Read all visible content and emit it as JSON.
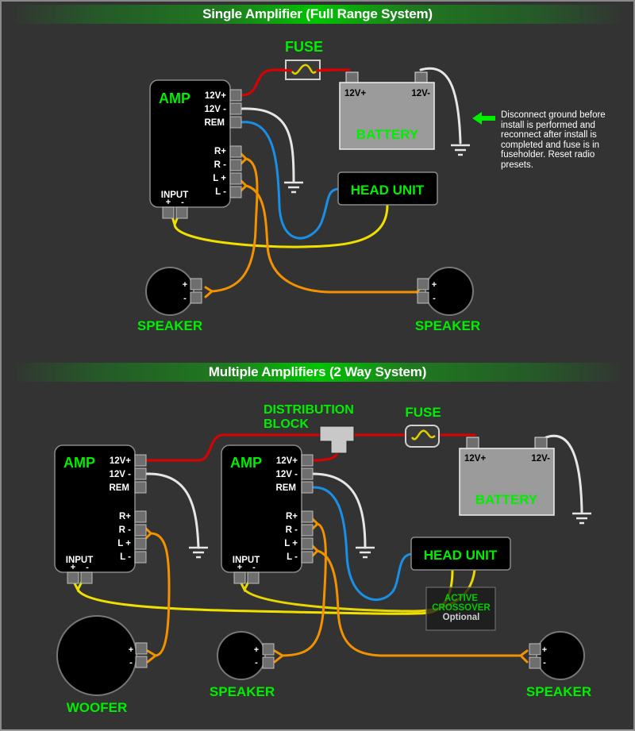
{
  "sections": [
    {
      "title": "Single Amplifier (Full Range System)",
      "fuse_label": "FUSE",
      "amp": {
        "label": "AMP",
        "terminals": [
          "12V+",
          "12V -",
          "REM",
          "R+",
          "R -",
          "L +",
          "L -"
        ],
        "input_label": "INPUT",
        "input_pos": "+",
        "input_neg": "-"
      },
      "battery": {
        "label": "BATTERY",
        "pos": "12V+",
        "neg": "12V-"
      },
      "head_unit": "HEAD UNIT",
      "speakers": [
        {
          "label": "SPEAKER",
          "pos": "+",
          "neg": "-"
        },
        {
          "label": "SPEAKER",
          "pos": "+",
          "neg": "-"
        }
      ],
      "note": "Disconnect ground before install is performed and reconnect after install is completed and fuse is in fuseholder. Reset radio presets."
    },
    {
      "title": "Multiple Amplifiers (2 Way System)",
      "distribution_block": [
        "DISTRIBUTION",
        "BLOCK"
      ],
      "fuse_label": "FUSE",
      "amps": [
        {
          "label": "AMP",
          "terminals": [
            "12V+",
            "12V -",
            "REM",
            "R+",
            "R -",
            "L +",
            "L -"
          ],
          "input_label": "INPUT",
          "input_pos": "+",
          "input_neg": "-"
        },
        {
          "label": "AMP",
          "terminals": [
            "12V+",
            "12V -",
            "REM",
            "R+",
            "R -",
            "L +",
            "L -"
          ],
          "input_label": "INPUT",
          "input_pos": "+",
          "input_neg": "-"
        }
      ],
      "battery": {
        "label": "BATTERY",
        "pos": "12V+",
        "neg": "12V-"
      },
      "head_unit": "HEAD UNIT",
      "crossover": {
        "line1": "ACTIVE",
        "line2": "CROSSOVER",
        "line3": "Optional"
      },
      "woofer": {
        "label": "WOOFER",
        "pos": "+",
        "neg": "-"
      },
      "speakers": [
        {
          "label": "SPEAKER",
          "pos": "+",
          "neg": "-"
        },
        {
          "label": "SPEAKER",
          "pos": "+",
          "neg": "-"
        }
      ]
    }
  ],
  "colors": {
    "label_green": "#00ee00",
    "power_red": "#dd0000",
    "ground_white": "#e6e6e6",
    "remote_blue": "#1a8fe6",
    "signal_yellow": "#f0e000",
    "speaker_orange": "#f29200"
  }
}
